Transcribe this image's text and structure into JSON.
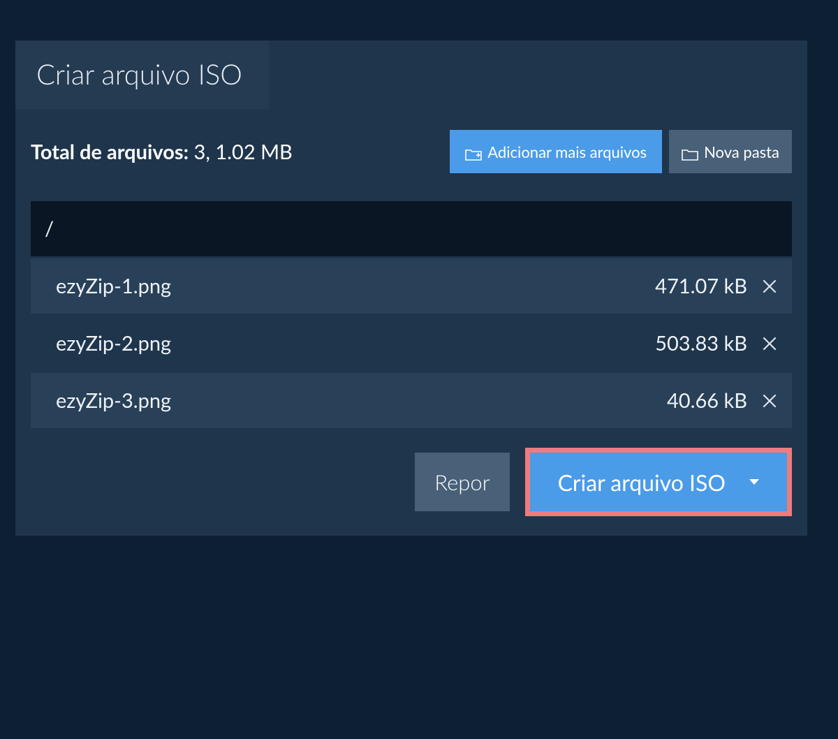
{
  "tab": {
    "title": "Criar arquivo ISO"
  },
  "toolbar": {
    "total_label": "Total de arquivos:",
    "total_value": "3, 1.02 MB",
    "add_files_label": "Adicionar mais arquivos",
    "new_folder_label": "Nova pasta"
  },
  "path": "/",
  "files": [
    {
      "name": "ezyZip-1.png",
      "size": "471.07 kB"
    },
    {
      "name": "ezyZip-2.png",
      "size": "503.83 kB"
    },
    {
      "name": "ezyZip-3.png",
      "size": "40.66 kB"
    }
  ],
  "actions": {
    "reset_label": "Repor",
    "create_label": "Criar arquivo ISO"
  }
}
